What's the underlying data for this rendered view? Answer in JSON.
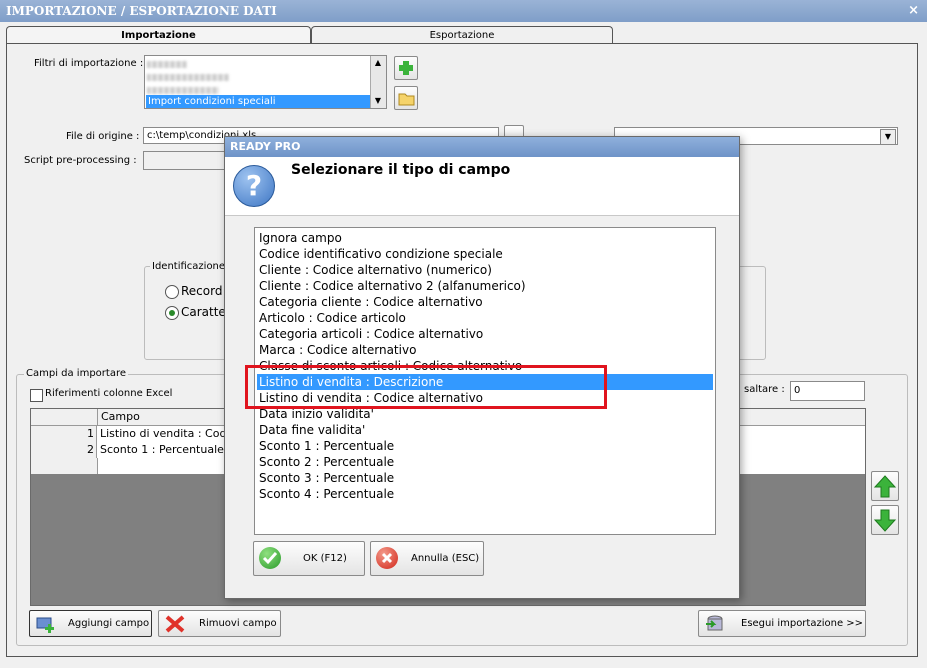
{
  "window": {
    "title": "IMPORTAZIONE / ESPORTAZIONE DATI",
    "close_glyph": "×"
  },
  "tabs": [
    {
      "label": "Importazione",
      "active": true
    },
    {
      "label": "Esportazione",
      "active": false
    }
  ],
  "form": {
    "filtri_label": "Filtri di importazione :",
    "filtri_selected": "Import condizioni speciali",
    "file_origine_label": "File di origine :",
    "file_origine_value": "c:\\temp\\condizioni.xls",
    "script_label": "Script pre-processing :",
    "identificazione_label": "Identificazione",
    "radio_record": "Record a",
    "radio_caratteri": "Carattere"
  },
  "campi": {
    "group_label": "Campi da importare",
    "riferimenti_label": "Riferimenti colonne Excel",
    "saltare_label": "saltare :",
    "saltare_value": "0",
    "column_header": "Campo",
    "rows": [
      {
        "num": "1",
        "campo": "Listino di vendita : Codice"
      },
      {
        "num": "2",
        "campo": "Sconto 1 : Percentuale"
      }
    ]
  },
  "bottom": {
    "aggiungi": "Aggiungi campo",
    "rimuovi": "Rimuovi campo",
    "esegui": "Esegui importazione >>"
  },
  "dialog": {
    "title": "READY PRO",
    "heading": "Selezionare il tipo di campo",
    "icon": "question-icon",
    "items": [
      "Ignora campo",
      "Codice identificativo condizione speciale",
      "Cliente : Codice alternativo (numerico)",
      "Cliente : Codice alternativo 2 (alfanumerico)",
      "Categoria cliente : Codice alternativo",
      "Articolo : Codice articolo",
      "Categoria articoli : Codice alternativo",
      "Marca : Codice alternativo",
      "Classe di sconto articoli : Codice alternativo",
      "Listino di vendita : Descrizione",
      "Listino di vendita : Codice alternativo",
      "Data inizio validita'",
      "Data fine validita'",
      "Sconto 1 : Percentuale",
      "Sconto 2 : Percentuale",
      "Sconto 3 : Percentuale",
      "Sconto 4 : Percentuale"
    ],
    "selected_index": 9,
    "ok_label": "OK (F12)",
    "cancel_label": "Annulla (ESC)"
  },
  "colors": {
    "highlight": "#3399ff",
    "annotation": "#e0141e",
    "titlebar": "#8aa8d2"
  }
}
